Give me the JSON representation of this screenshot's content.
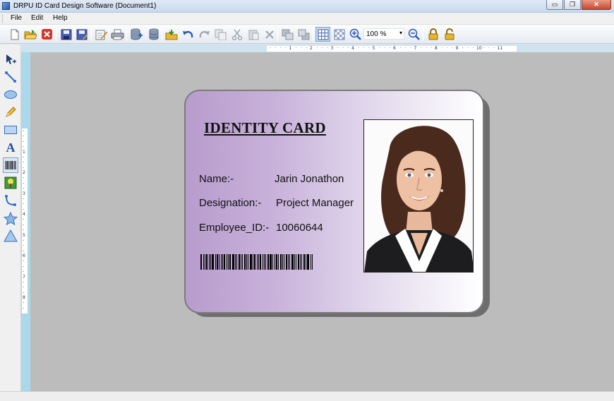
{
  "window": {
    "title": "DRPU ID Card Design Software  (Document1)",
    "min": "▭",
    "max": "❐",
    "close": "✕"
  },
  "menu": {
    "file": "File",
    "edit": "Edit",
    "help": "Help"
  },
  "toolbar": {
    "zoom_value": "100 %",
    "zoom_arrow": "▾"
  },
  "ruler": {
    "horizontal": [
      "1",
      "2",
      "3",
      "4",
      "5",
      "6",
      "7",
      "8",
      "9",
      "10",
      "11"
    ],
    "vertical": [
      "1",
      "2",
      "3",
      "4",
      "5",
      "6",
      "7",
      "8",
      "9"
    ]
  },
  "card": {
    "title": "IDENTITY CARD",
    "fields": [
      {
        "label": "Name:-",
        "value": "Jarin Jonathon"
      },
      {
        "label": "Designation:-",
        "value": "Project Manager"
      },
      {
        "label": "Employee_ID:-",
        "value": "10060644"
      }
    ]
  },
  "icons": {
    "toolbar": [
      "new-icon",
      "open-icon",
      "close-doc-icon",
      "save-icon",
      "save-as-icon",
      "edit-icon",
      "print-icon",
      "database-export-icon",
      "database-icon",
      "import-icon",
      "undo-icon",
      "redo-icon",
      "copy-icon",
      "cut-icon",
      "paste-icon",
      "delete-icon",
      "bring-front-icon",
      "send-back-icon",
      "grid-icon",
      "transparent-icon",
      "zoom-in-icon",
      "zoom-out-icon",
      "lock-icon",
      "unlock-icon"
    ],
    "tools": [
      "pointer-icon",
      "line-icon",
      "ellipse-icon",
      "pencil-icon",
      "rectangle-icon",
      "text-icon",
      "barcode-icon",
      "picture-icon",
      "arc-icon",
      "star-icon",
      "triangle-icon"
    ]
  },
  "colors": {
    "card_gradient_start": "#b79ccd",
    "card_gradient_end": "#ffffff",
    "canvas": "#bcbcbc"
  }
}
